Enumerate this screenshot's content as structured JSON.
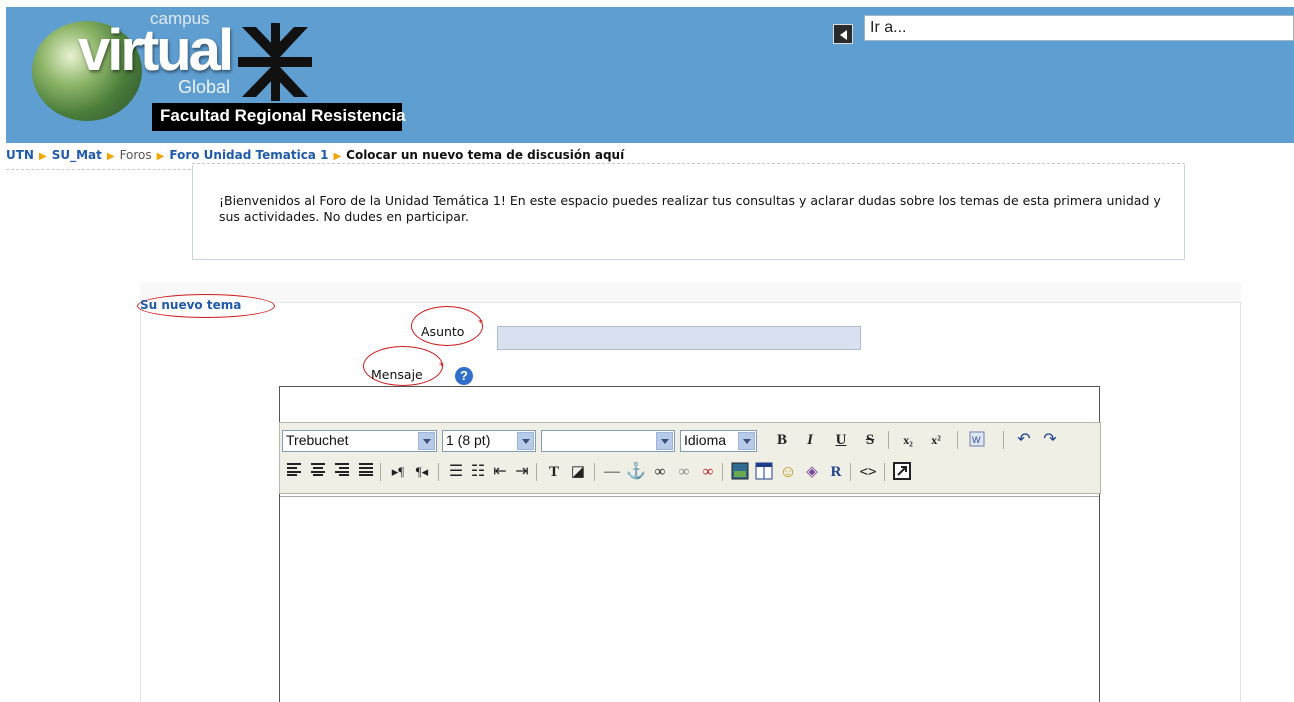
{
  "header": {
    "logo": {
      "campus": "campus",
      "virtual": "virtual",
      "global": "Global",
      "faculty": "Facultad Regional Resistencia"
    },
    "goto": {
      "value": "Ir a..."
    }
  },
  "breadcrumb": {
    "items": [
      "UTN",
      "SU_Mat",
      "Foros",
      "Foro Unidad Tematica 1",
      "Colocar un nuevo tema de discusión aquí"
    ]
  },
  "intro": {
    "text": "¡Bienvenidos al Foro de la Unidad Temática 1! En este espacio puedes realizar tus consultas y aclarar dudas sobre los temas de esta primera unidad y sus actividades. No dudes en participar."
  },
  "form": {
    "legend": "Su nuevo tema",
    "subject_label": "Asunto",
    "message_label": "Mensaje",
    "required_mark": "*",
    "subject_value": ""
  },
  "editor": {
    "font": "Trebuchet",
    "size": "1 (8 pt)",
    "style": "",
    "language": "Idioma",
    "icons_row1": [
      "bold-icon",
      "italic-icon",
      "underline-icon",
      "strikethrough-icon",
      "subscript-icon",
      "superscript-icon",
      "paste-word-icon",
      "undo-icon",
      "redo-icon"
    ],
    "icons_row2": [
      "align-left-icon",
      "align-center-icon",
      "align-right-icon",
      "justify-icon",
      "ltr-icon",
      "rtl-icon",
      "ordered-list-icon",
      "unordered-list-icon",
      "outdent-icon",
      "indent-icon",
      "text-color-icon",
      "background-color-icon",
      "horizontal-rule-icon",
      "anchor-icon",
      "link-icon",
      "unlink-icon",
      "nolink-icon",
      "image-icon",
      "table-icon",
      "smiley-icon",
      "special-char-icon",
      "search-replace-icon",
      "html-source-icon",
      "fullscreen-icon"
    ],
    "glyphs": {
      "bold": "B",
      "italic": "I",
      "underline": "U",
      "strike": "S",
      "sub": "x₂",
      "sup": "x²"
    }
  }
}
